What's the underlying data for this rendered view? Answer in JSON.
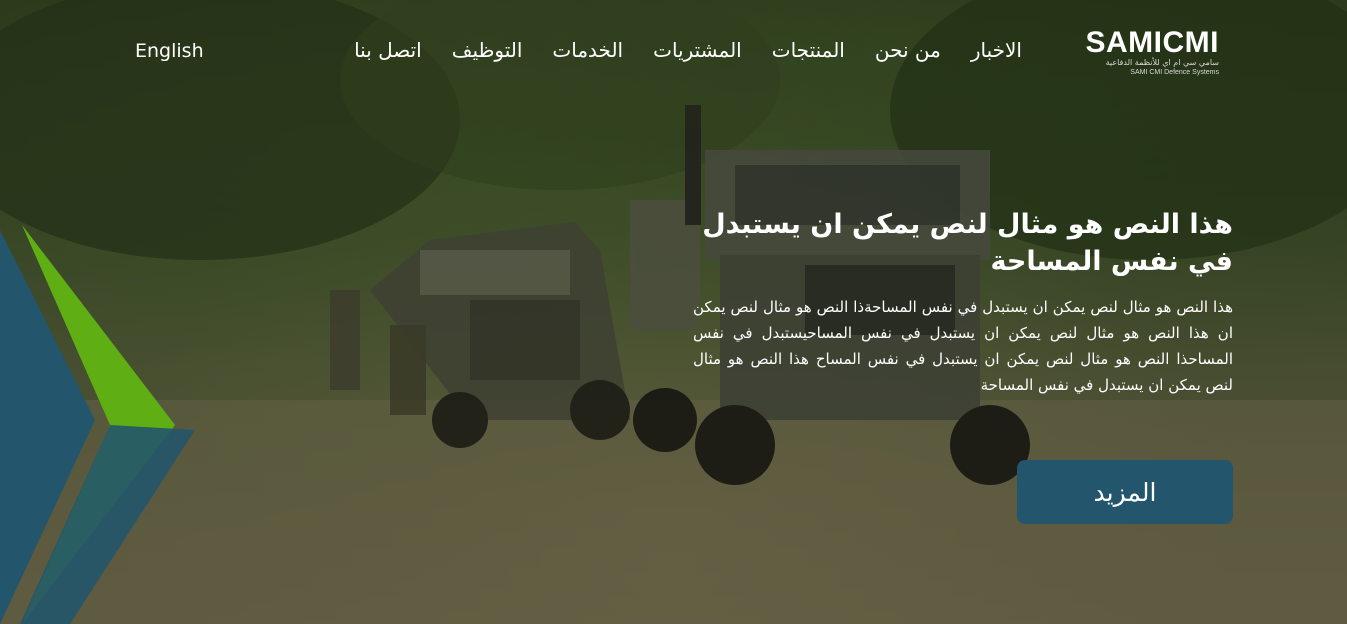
{
  "brand": {
    "logo_text": "SAMICMI",
    "logo_subtitle_ar": "سامي سي ام اي للأنظمة الدفاعية",
    "logo_subtitle_en": "SAMI CMI Defence Systems"
  },
  "header": {
    "language_label": "English",
    "nav": [
      "الاخبار",
      "من نحن",
      "المنتجات",
      "المشتريات",
      "الخدمات",
      "التوظيف",
      "اتصل بنا"
    ]
  },
  "hero": {
    "title": "هذا النص هو مثال لنص يمكن ان يستبدل في نفس المساحة",
    "body": "هذا النص هو مثال لنص يمكن ان يستبدل في نفس المساحةذا النص هو مثال لنص يمكن ان هذا النص هو مثال لنص يمكن ان يستبدل في نفس المساحيستبدل في نفس المساحذا النص هو مثال لنص يمكن ان يستبدل في نفس المساح هذا النص هو مثال لنص يمكن ان يستبدل في نفس المساحة",
    "more_label": "المزيد"
  },
  "colors": {
    "accent_blue": "#23556c",
    "accent_green": "#5fae14"
  }
}
